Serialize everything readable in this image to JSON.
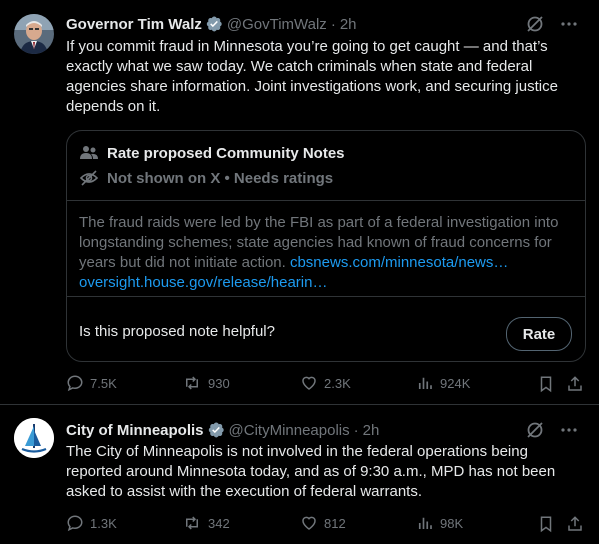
{
  "tweets": [
    {
      "author": "Governor Tim Walz",
      "handle": "@GovTimWalz",
      "separator": "·",
      "time": "2h",
      "text": "If you commit fraud in Minnesota you’re going to get caught — and that’s exactly what we saw today. We catch criminals when state and federal agencies share information. Joint investigations work, and securing justice depends on it.",
      "community_notes": {
        "title": "Rate proposed Community Notes",
        "status": "Not shown on X • Needs ratings",
        "note_text": "The fraud raids were led by the FBI as part of a federal investigation into longstanding schemes; state agencies had known of fraud concerns for years but did not initiate action.",
        "link1": "cbsnews.com/minnesota/news…",
        "link2": "oversight.house.gov/release/hearin…",
        "question": "Is this proposed note helpful?",
        "rate_label": "Rate"
      },
      "stats": {
        "replies": "7.5K",
        "reposts": "930",
        "likes": "2.3K",
        "views": "924K"
      }
    },
    {
      "author": "City of Minneapolis",
      "handle": "@CityMinneapolis",
      "separator": "·",
      "time": "2h",
      "text": "The City of Minneapolis is not involved in the federal operations being reported around Minnesota today, and as of 9:30 a.m., MPD has not been asked to assist with the execution of federal warrants.",
      "stats": {
        "replies": "1.3K",
        "reposts": "342",
        "likes": "812",
        "views": "98K"
      }
    }
  ],
  "icons": {
    "verified": "verified-badge-icon",
    "grok": "grok-icon",
    "more": "more-icon",
    "reply": "reply-icon",
    "repost": "repost-icon",
    "like": "like-icon",
    "views": "views-icon",
    "bookmark": "bookmark-icon",
    "share": "share-icon",
    "people": "people-icon",
    "eye_off": "eye-off-icon"
  },
  "colors": {
    "background": "#000000",
    "text": "#e7e9ea",
    "muted": "#71767b",
    "link": "#1d9bf0",
    "verified": "#829aab",
    "border": "#2f3336"
  }
}
